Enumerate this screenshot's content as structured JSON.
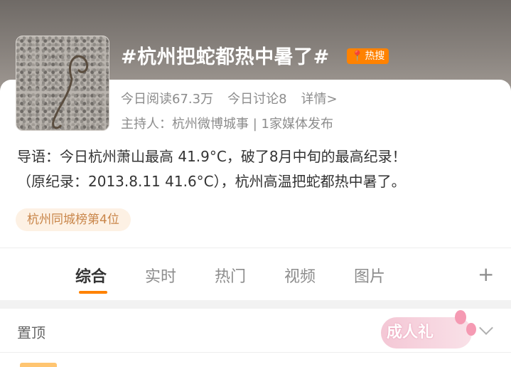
{
  "topic": {
    "title": "#杭州把蛇都热中暑了#",
    "hot_badge": "热搜",
    "reads": "今日阅读67.3万",
    "discussions": "今日讨论8",
    "details_link": "详情>",
    "host": "主持人：杭州微博城事 | 1家媒体发布",
    "intro_line1": "导语：今日杭州萧山最高 41.9°C，破了8月中旬的最高纪录！",
    "intro_line2": "（原纪录：2013.8.11  41.6°C），杭州高温把蛇都热中暑了。",
    "rank_tag": "杭州同城榜第4位"
  },
  "tabs": [
    {
      "label": "综合"
    },
    {
      "label": "实时"
    },
    {
      "label": "热门"
    },
    {
      "label": "视频"
    },
    {
      "label": "图片"
    }
  ],
  "plus_label": "+",
  "pinned": {
    "label": "置顶",
    "sticker_text": "成人礼"
  },
  "colors": {
    "accent": "#ff8200",
    "muted_text": "#8c8c8c"
  }
}
